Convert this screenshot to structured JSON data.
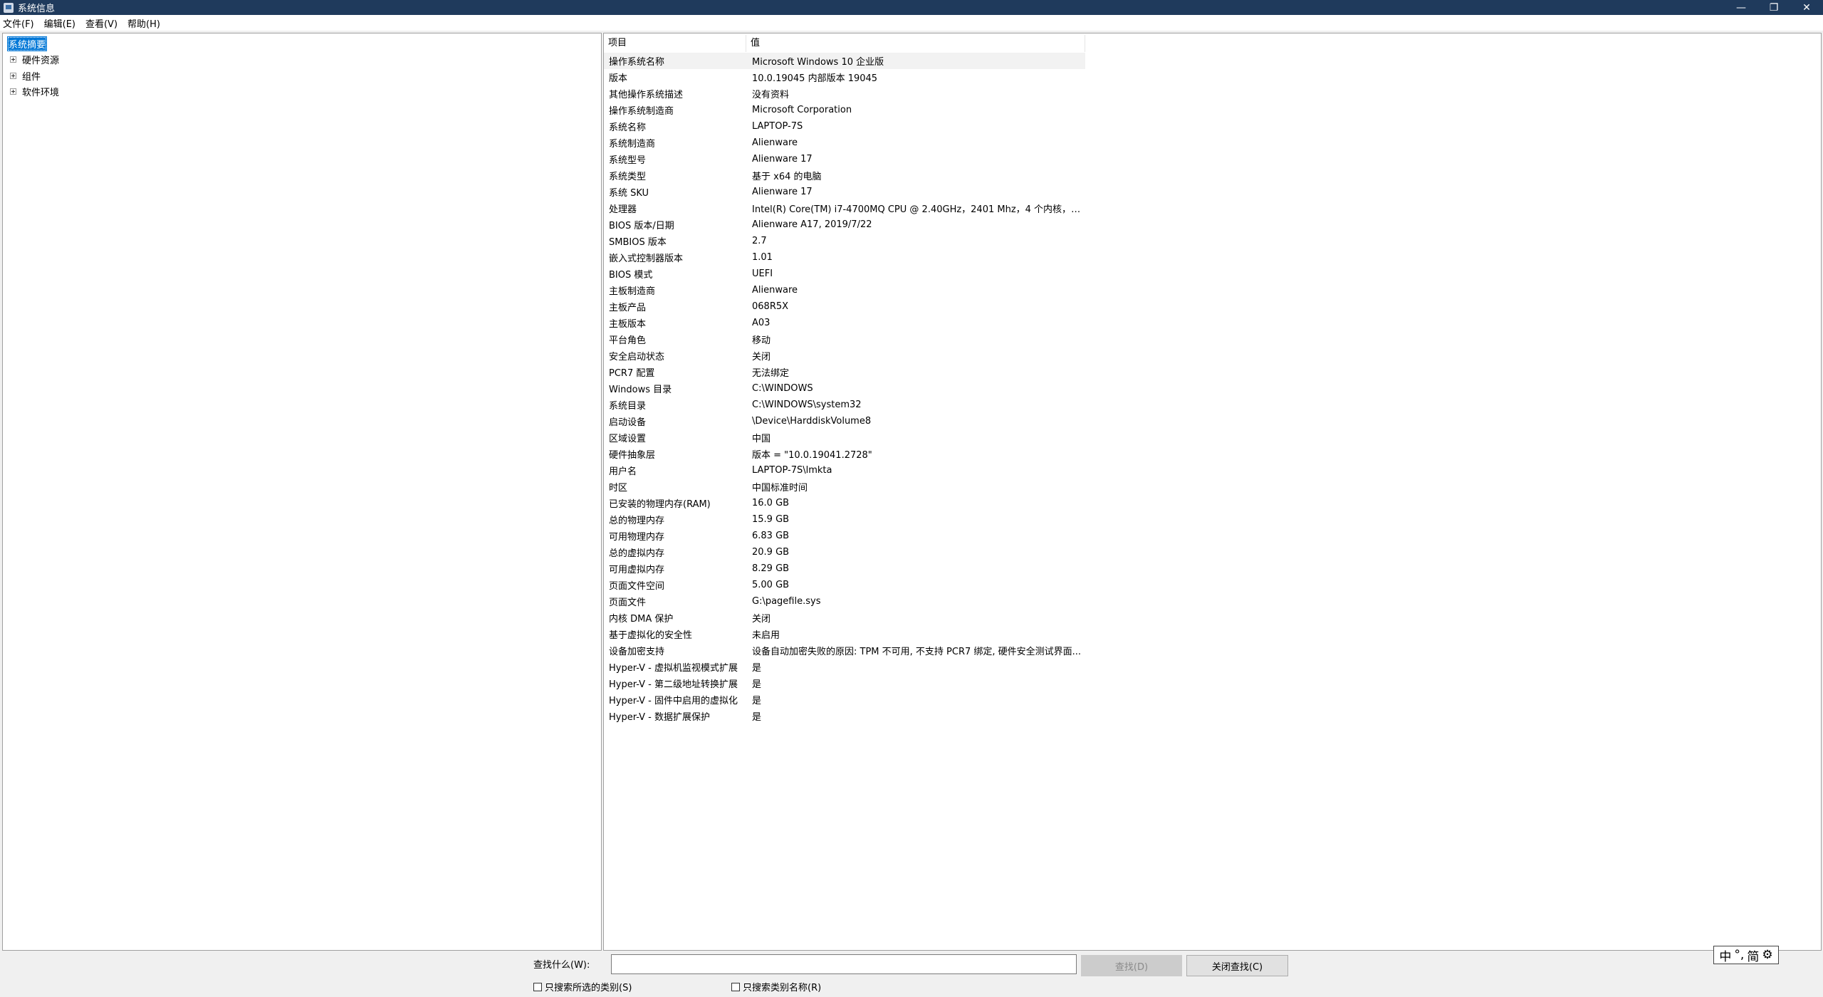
{
  "window": {
    "title": "系统信息",
    "minimize": "—",
    "restore": "❐",
    "close": "✕"
  },
  "menu": [
    "文件(F)",
    "编辑(E)",
    "查看(V)",
    "帮助(H)"
  ],
  "tree": {
    "root": "系统摘要",
    "nodes": [
      "硬件资源",
      "组件",
      "软件环境"
    ]
  },
  "table": {
    "headers": [
      "项目",
      "值"
    ],
    "rows": [
      [
        "操作系统名称",
        "Microsoft Windows 10 企业版"
      ],
      [
        "版本",
        "10.0.19045 内部版本 19045"
      ],
      [
        "其他操作系统描述",
        "没有资料"
      ],
      [
        "操作系统制造商",
        "Microsoft Corporation"
      ],
      [
        "系统名称",
        "LAPTOP-7S"
      ],
      [
        "系统制造商",
        "Alienware"
      ],
      [
        "系统型号",
        "Alienware 17"
      ],
      [
        "系统类型",
        "基于 x64 的电脑"
      ],
      [
        "系统 SKU",
        "Alienware 17"
      ],
      [
        "处理器",
        "Intel(R) Core(TM) i7-4700MQ CPU @ 2.40GHz，2401 Mhz，4 个内核，8 ..."
      ],
      [
        "BIOS 版本/日期",
        "Alienware A17, 2019/7/22"
      ],
      [
        "SMBIOS 版本",
        "2.7"
      ],
      [
        "嵌入式控制器版本",
        "1.01"
      ],
      [
        "BIOS 模式",
        "UEFI"
      ],
      [
        "主板制造商",
        "Alienware"
      ],
      [
        "主板产品",
        "068R5X"
      ],
      [
        "主板版本",
        "A03"
      ],
      [
        "平台角色",
        "移动"
      ],
      [
        "安全启动状态",
        "关闭"
      ],
      [
        "PCR7 配置",
        "无法绑定"
      ],
      [
        "Windows 目录",
        "C:\\WINDOWS"
      ],
      [
        "系统目录",
        "C:\\WINDOWS\\system32"
      ],
      [
        "启动设备",
        "\\Device\\HarddiskVolume8"
      ],
      [
        "区域设置",
        "中国"
      ],
      [
        "硬件抽象层",
        "版本 = \"10.0.19041.2728\""
      ],
      [
        "用户名",
        "LAPTOP-7S\\lmkta"
      ],
      [
        "时区",
        "中国标准时间"
      ],
      [
        "已安装的物理内存(RAM)",
        "16.0 GB"
      ],
      [
        "总的物理内存",
        "15.9 GB"
      ],
      [
        "可用物理内存",
        "6.83 GB"
      ],
      [
        "总的虚拟内存",
        "20.9 GB"
      ],
      [
        "可用虚拟内存",
        "8.29 GB"
      ],
      [
        "页面文件空间",
        "5.00 GB"
      ],
      [
        "页面文件",
        "G:\\pagefile.sys"
      ],
      [
        "内核 DMA 保护",
        "关闭"
      ],
      [
        "基于虚拟化的安全性",
        "未启用"
      ],
      [
        "设备加密支持",
        "设备自动加密失败的原因: TPM 不可用, 不支持 PCR7 绑定, 硬件安全测试界面..."
      ],
      [
        "Hyper-V - 虚拟机监视模式扩展",
        "是"
      ],
      [
        "Hyper-V - 第二级地址转换扩展",
        "是"
      ],
      [
        "Hyper-V - 固件中启用的虚拟化",
        "是"
      ],
      [
        "Hyper-V - 数据扩展保护",
        "是"
      ]
    ]
  },
  "search": {
    "label": "查找什么(W):",
    "value": "",
    "find_button": "查找(D)",
    "close_find_button": "关闭查找(C)",
    "check_selected_category": "只搜索所选的类别(S)",
    "check_category_names": "只搜索类别名称(R)"
  },
  "ime": {
    "lang": "中",
    "punct": "°,",
    "mode": "简",
    "settings_icon": "⚙"
  }
}
